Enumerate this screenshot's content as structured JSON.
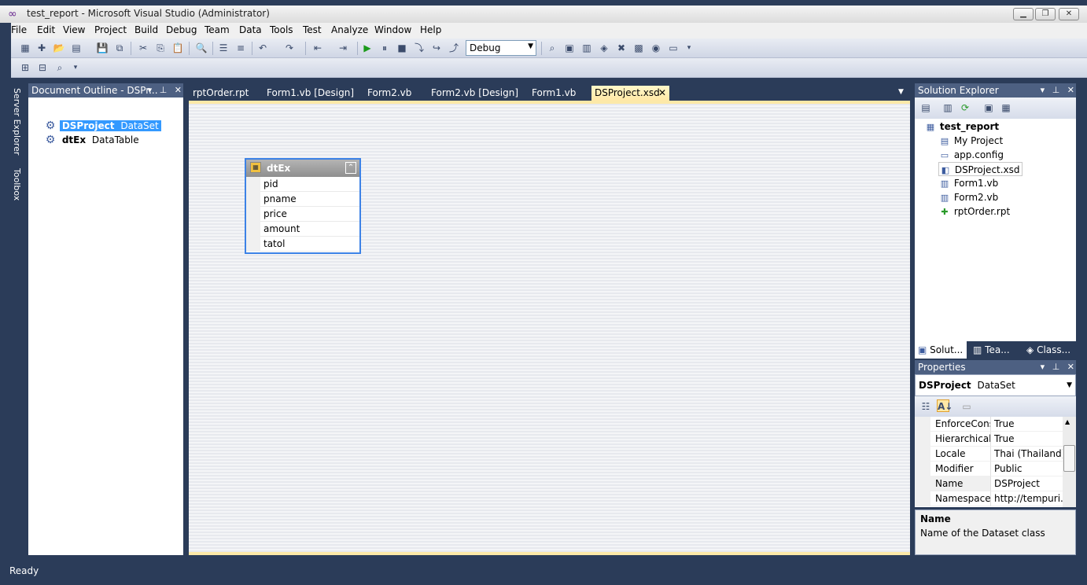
{
  "window": {
    "title": "test_report - Microsoft Visual Studio (Administrator)",
    "minimize": "▁",
    "maximize": "❐",
    "close": "✕"
  },
  "menu": [
    "File",
    "Edit",
    "View",
    "Project",
    "Build",
    "Debug",
    "Team",
    "Data",
    "Tools",
    "Test",
    "Analyze",
    "Window",
    "Help"
  ],
  "toolbar": {
    "configuration": "Debug"
  },
  "left_strip": [
    "Server Explorer",
    "Toolbox"
  ],
  "document_outline": {
    "title": "Document Outline - DSPr...",
    "items": [
      {
        "name": "DSProject",
        "type": "DataSet"
      },
      {
        "name": "dtEx",
        "type": "DataTable"
      }
    ]
  },
  "tabs": [
    "rptOrder.rpt",
    "Form1.vb [Design]",
    "Form2.vb",
    "Form2.vb [Design]",
    "Form1.vb",
    "DSProject.xsd"
  ],
  "active_tab": "DSProject.xsd",
  "datatable": {
    "name": "dtEx",
    "columns": [
      "pid",
      "pname",
      "price",
      "amount",
      "tatol"
    ]
  },
  "solution_explorer": {
    "title": "Solution Explorer",
    "project": "test_report",
    "items": [
      "My Project",
      "app.config",
      "DSProject.xsd",
      "Form1.vb",
      "Form2.vb",
      "rptOrder.rpt"
    ],
    "bottom_tabs": [
      "Solut...",
      "Tea...",
      "Class..."
    ]
  },
  "properties": {
    "title": "Properties",
    "object": "DSProject",
    "object_type": "DataSet",
    "rows": [
      {
        "name": "EnforceConst",
        "value": "True"
      },
      {
        "name": "Hierarchical U",
        "value": "True"
      },
      {
        "name": "Locale",
        "value": "Thai (Thailand)"
      },
      {
        "name": "Modifier",
        "value": "Public"
      },
      {
        "name": "Name",
        "value": "DSProject"
      },
      {
        "name": "Namespace",
        "value": "http://tempuri.o"
      }
    ],
    "desc_title": "Name",
    "desc_text": "Name of the Dataset class"
  },
  "status": "Ready",
  "colors": {
    "chrome": "#2b3c59",
    "active_tab": "#ffe8a6",
    "selection": "#3399ff"
  }
}
